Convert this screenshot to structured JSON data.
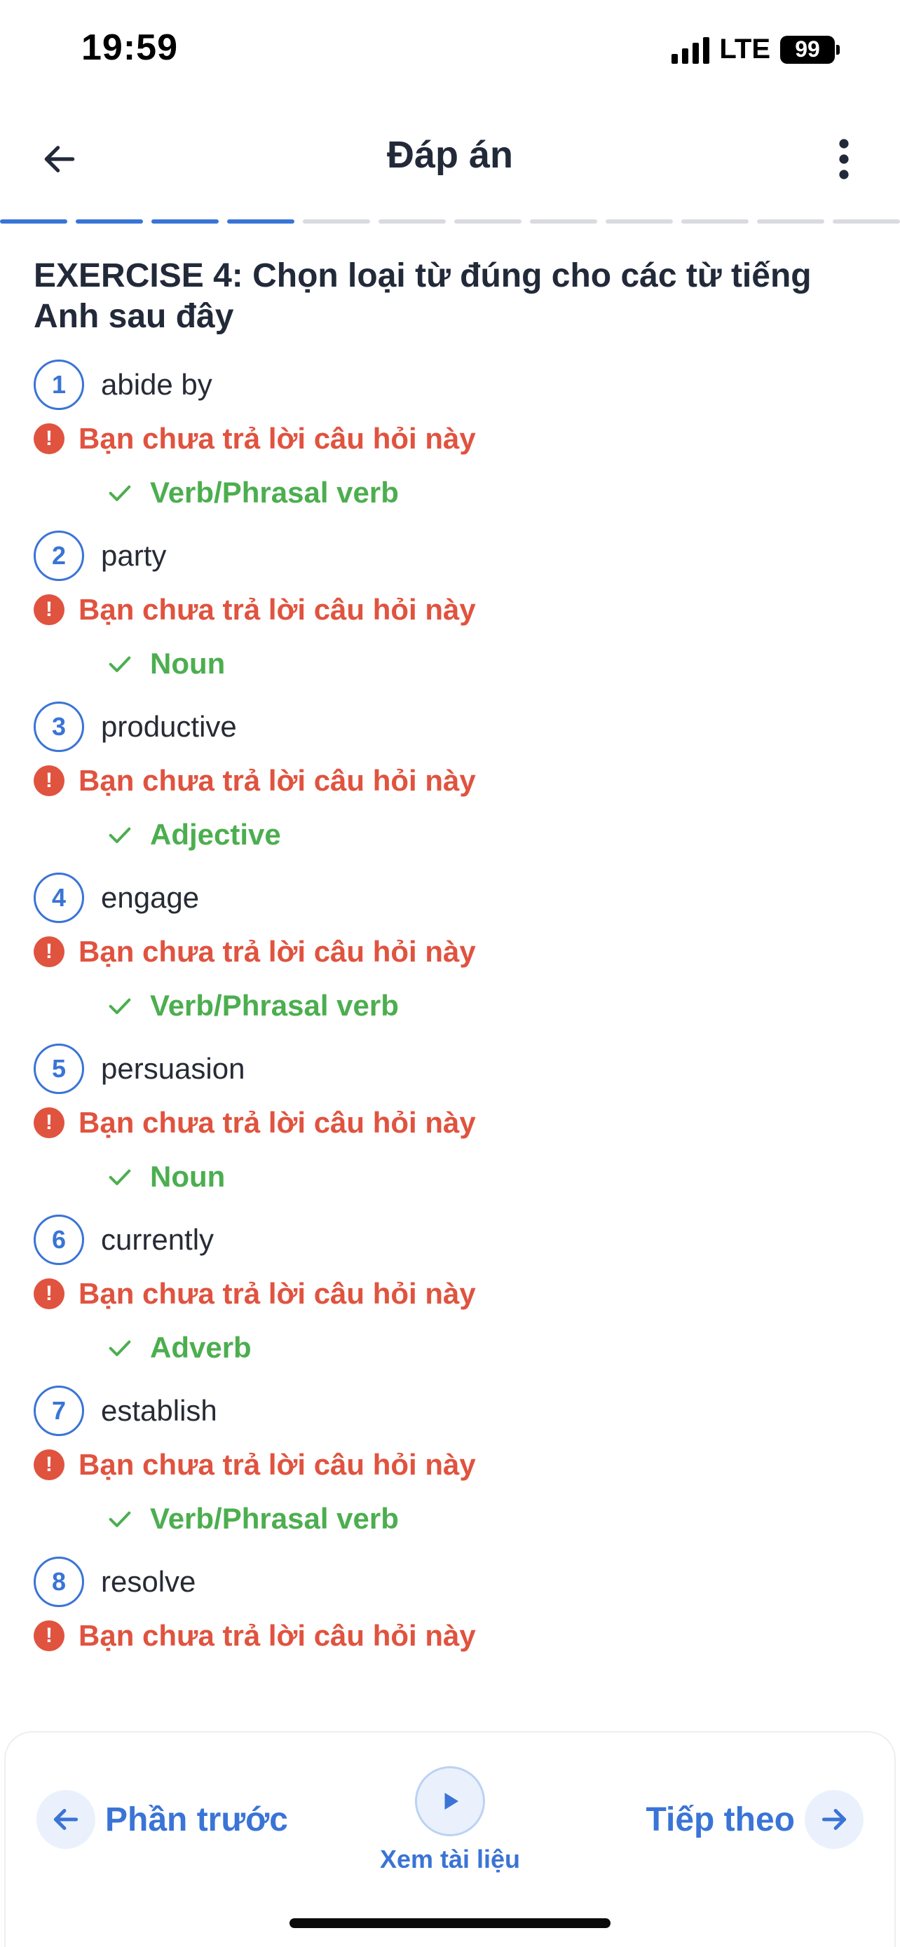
{
  "status_bar": {
    "time": "19:59",
    "network": "LTE",
    "battery": "99"
  },
  "header": {
    "title": "Đáp án",
    "back_icon": "arrow-left-icon",
    "more_icon": "more-vertical-icon"
  },
  "progress": {
    "total_segments": 12,
    "completed_segments": 4
  },
  "exercise": {
    "title": "EXERCISE 4: Chọn loại từ đúng cho các từ tiếng Anh sau đây",
    "questions": [
      {
        "number": "1",
        "word": "abide by",
        "status": "Bạn chưa trả lời câu hỏi này",
        "answer": "Verb/Phrasal verb"
      },
      {
        "number": "2",
        "word": "party",
        "status": "Bạn chưa trả lời câu hỏi này",
        "answer": "Noun"
      },
      {
        "number": "3",
        "word": "productive",
        "status": "Bạn chưa trả lời câu hỏi này",
        "answer": "Adjective"
      },
      {
        "number": "4",
        "word": "engage",
        "status": "Bạn chưa trả lời câu hỏi này",
        "answer": "Verb/Phrasal verb"
      },
      {
        "number": "5",
        "word": "persuasion",
        "status": "Bạn chưa trả lời câu hỏi này",
        "answer": "Noun"
      },
      {
        "number": "6",
        "word": "currently",
        "status": "Bạn chưa trả lời câu hỏi này",
        "answer": "Adverb"
      },
      {
        "number": "7",
        "word": "establish",
        "status": "Bạn chưa trả lời câu hỏi này",
        "answer": "Verb/Phrasal verb"
      },
      {
        "number": "8",
        "word": "resolve",
        "status": "Bạn chưa trả lời câu hỏi này",
        "answer": ""
      }
    ]
  },
  "bottom_bar": {
    "prev_label": "Phần trước",
    "doc_label": "Xem tài liệu",
    "next_label": "Tiếp theo"
  },
  "colors": {
    "accent": "#3a74d6",
    "error": "#e0533f",
    "success": "#4cae4f",
    "progress_inactive": "#d9dbe0"
  }
}
